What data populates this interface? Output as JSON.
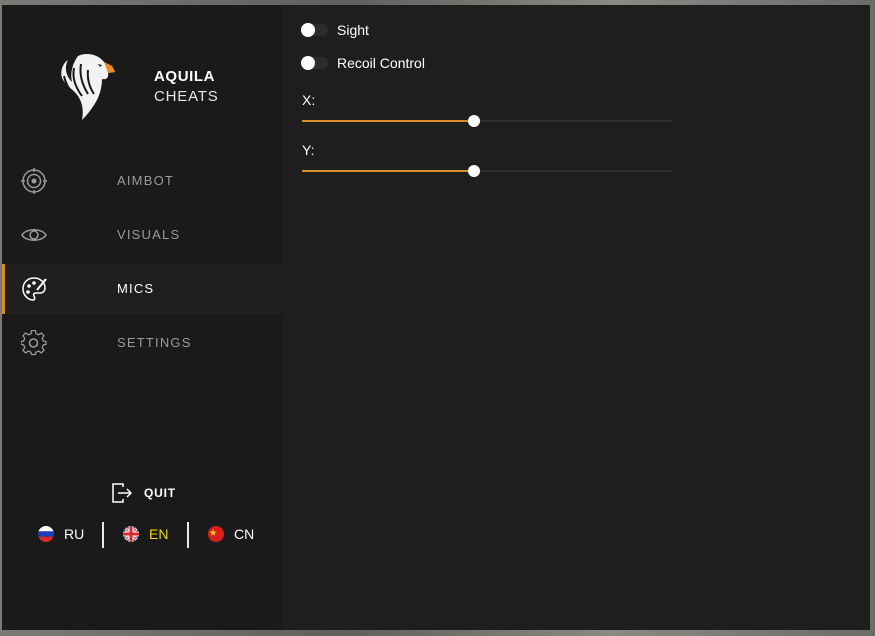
{
  "brand": {
    "line1": "AQUILA",
    "line2": "CHEATS"
  },
  "nav": [
    {
      "id": "aimbot",
      "label": "AIMBOT",
      "icon": "target-icon",
      "active": false
    },
    {
      "id": "visuals",
      "label": "VISUALS",
      "icon": "eye-icon",
      "active": false
    },
    {
      "id": "mics",
      "label": "MICS",
      "icon": "palette-icon",
      "active": true
    },
    {
      "id": "settings",
      "label": "SETTINGS",
      "icon": "gear-icon",
      "active": false
    }
  ],
  "quit": {
    "label": "QUIT",
    "icon": "exit-icon"
  },
  "languages": [
    {
      "code": "RU",
      "flag": "russia-flag-icon",
      "active": false
    },
    {
      "code": "EN",
      "flag": "uk-flag-icon",
      "active": true
    },
    {
      "code": "CN",
      "flag": "china-flag-icon",
      "active": false
    }
  ],
  "options": {
    "sight": {
      "label": "Sight",
      "enabled": false
    },
    "recoil": {
      "label": "Recoil Control",
      "enabled": false
    }
  },
  "sliders": {
    "x": {
      "label": "X:",
      "fraction": 0.466
    },
    "y": {
      "label": "Y:",
      "fraction": 0.466
    }
  },
  "colors": {
    "accent": "#d98a2b",
    "active_lang": "#f1d317",
    "sidebar_bg": "#1a1a1a",
    "content_bg": "#1e1e1e"
  }
}
